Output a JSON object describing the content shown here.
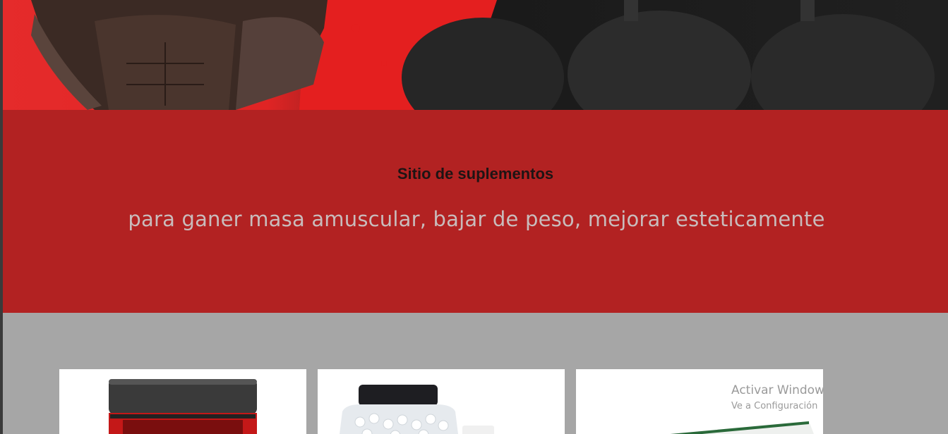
{
  "hero": {
    "image": "bodybuilder-banner",
    "colors": {
      "red": "#e52b2b",
      "dark": "#1a1a1a"
    }
  },
  "band": {
    "title": "Sitio de suplementos",
    "subtitle": "para ganer masa amuscular, bajar de peso, mejorar esteticamente",
    "background": "#b22222"
  },
  "products": {
    "background": "#a6a6a6",
    "cards": [
      {
        "image": "red-supplement-jar"
      },
      {
        "image": "white-pill-bottle"
      },
      {
        "image": "clenbuterol-box"
      }
    ]
  },
  "watermark": {
    "title": "Activar Windows",
    "subtitle": "Ve a Configuración"
  }
}
